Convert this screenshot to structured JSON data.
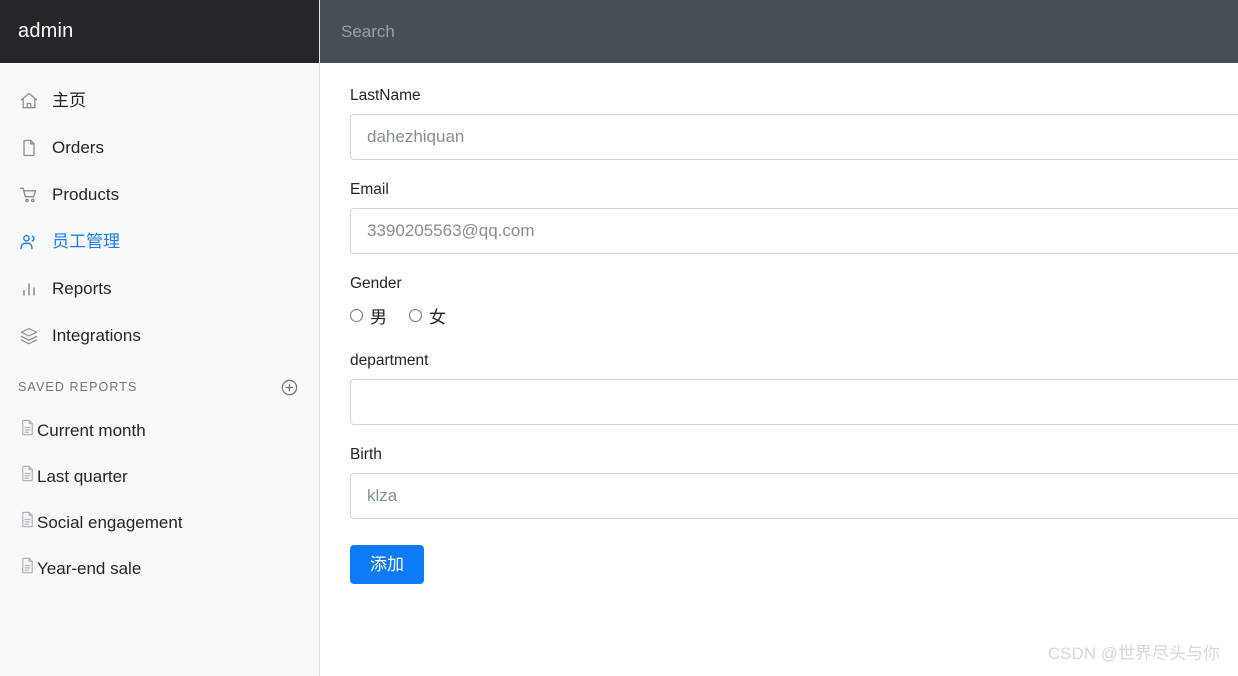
{
  "sidebar": {
    "brand": "admin",
    "nav_items": [
      {
        "label": "主页",
        "icon": "home-icon",
        "active": false
      },
      {
        "label": "Orders",
        "icon": "file-icon",
        "active": false
      },
      {
        "label": "Products",
        "icon": "shopping-cart-icon",
        "active": false
      },
      {
        "label": "员工管理",
        "icon": "users-icon",
        "active": true
      },
      {
        "label": "Reports",
        "icon": "bar-chart-icon",
        "active": false
      },
      {
        "label": "Integrations",
        "icon": "layers-icon",
        "active": false
      }
    ],
    "saved_reports": {
      "title": "SAVED REPORTS",
      "add_icon": "plus-circle-icon",
      "items": [
        {
          "label": "Current month",
          "icon": "document-icon"
        },
        {
          "label": "Last quarter",
          "icon": "document-icon"
        },
        {
          "label": "Social engagement",
          "icon": "document-icon"
        },
        {
          "label": "Year-end sale",
          "icon": "document-icon"
        }
      ]
    }
  },
  "topbar": {
    "search_placeholder": "Search",
    "search_value": ""
  },
  "form": {
    "fields": [
      {
        "label": "LastName",
        "value": "",
        "placeholder": "dahezhiquan"
      },
      {
        "label": "Email",
        "value": "",
        "placeholder": "3390205563@qq.com"
      },
      {
        "label": "department",
        "value": "",
        "placeholder": ""
      },
      {
        "label": "Birth",
        "value": "",
        "placeholder": "klza"
      }
    ],
    "gender": {
      "label": "Gender",
      "options": [
        {
          "label": "男",
          "checked": false
        },
        {
          "label": "女",
          "checked": false
        }
      ]
    },
    "submit_label": "添加"
  },
  "watermark": "CSDN @世界尽头与你",
  "colors": {
    "sidebar_header_bg": "#23272b",
    "topbar_bg": "#474e54",
    "sidebar_bg": "#f8f9fa",
    "accent_blue": "#0d7bf7",
    "active_nav": "#1a7cf5",
    "input_border": "#ced4da"
  }
}
